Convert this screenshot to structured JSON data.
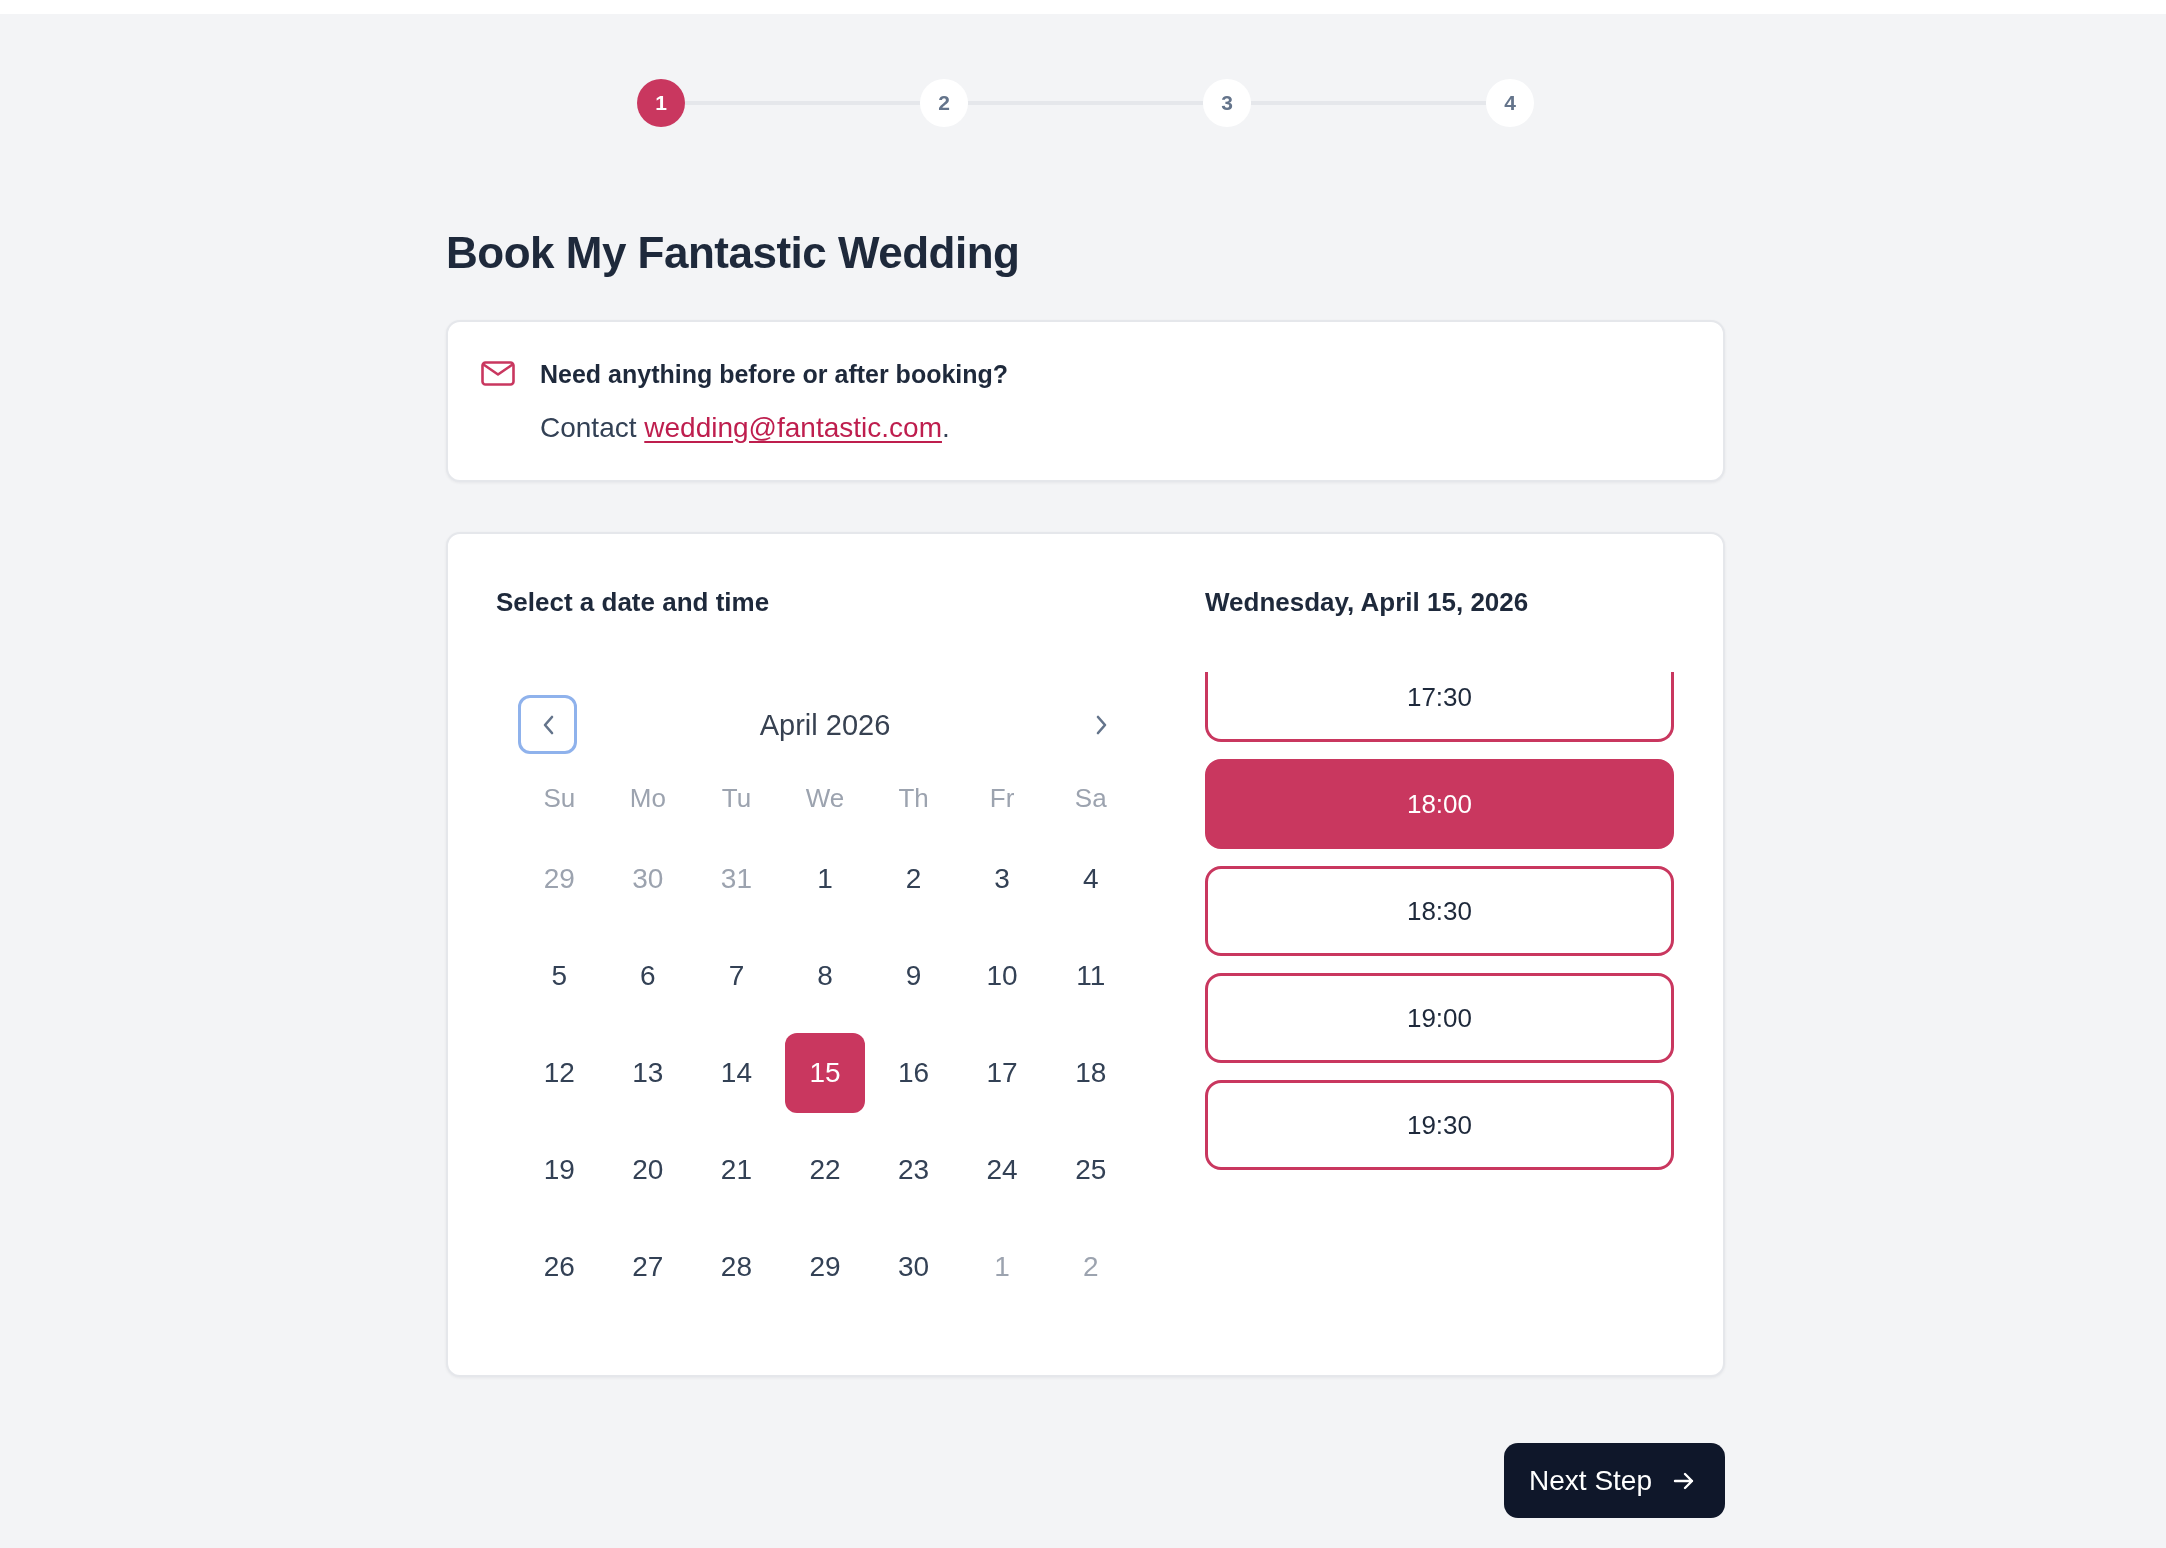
{
  "steps": [
    {
      "label": "1",
      "selected": true
    },
    {
      "label": "2",
      "selected": false
    },
    {
      "label": "3",
      "selected": false
    },
    {
      "label": "4",
      "selected": false
    }
  ],
  "title": "Book My Fantastic Wedding",
  "contact": {
    "heading": "Need anything before or after booking?",
    "prefix": "Contact",
    "email": "wedding@fantastic.com",
    "suffix": "."
  },
  "booking": {
    "heading": "Select a date and time",
    "calendar": {
      "month": "April 2026",
      "prev_button": {
        "focused": true
      },
      "weekdays": [
        "Su",
        "Mo",
        "Tu",
        "We",
        "Th",
        "Fr",
        "Sa"
      ],
      "days": [
        {
          "label": "29",
          "outside_month": true,
          "selected": false
        },
        {
          "label": "30",
          "outside_month": true,
          "selected": false
        },
        {
          "label": "31",
          "outside_month": true,
          "selected": false
        },
        {
          "label": "1",
          "outside_month": false,
          "selected": false
        },
        {
          "label": "2",
          "outside_month": false,
          "selected": false
        },
        {
          "label": "3",
          "outside_month": false,
          "selected": false
        },
        {
          "label": "4",
          "outside_month": false,
          "selected": false
        },
        {
          "label": "5",
          "outside_month": false,
          "selected": false
        },
        {
          "label": "6",
          "outside_month": false,
          "selected": false
        },
        {
          "label": "7",
          "outside_month": false,
          "selected": false
        },
        {
          "label": "8",
          "outside_month": false,
          "selected": false
        },
        {
          "label": "9",
          "outside_month": false,
          "selected": false
        },
        {
          "label": "10",
          "outside_month": false,
          "selected": false
        },
        {
          "label": "11",
          "outside_month": false,
          "selected": false
        },
        {
          "label": "12",
          "outside_month": false,
          "selected": false
        },
        {
          "label": "13",
          "outside_month": false,
          "selected": false
        },
        {
          "label": "14",
          "outside_month": false,
          "selected": false
        },
        {
          "label": "15",
          "outside_month": false,
          "selected": true
        },
        {
          "label": "16",
          "outside_month": false,
          "selected": false
        },
        {
          "label": "17",
          "outside_month": false,
          "selected": false
        },
        {
          "label": "18",
          "outside_month": false,
          "selected": false
        },
        {
          "label": "19",
          "outside_month": false,
          "selected": false
        },
        {
          "label": "20",
          "outside_month": false,
          "selected": false
        },
        {
          "label": "21",
          "outside_month": false,
          "selected": false
        },
        {
          "label": "22",
          "outside_month": false,
          "selected": false
        },
        {
          "label": "23",
          "outside_month": false,
          "selected": false
        },
        {
          "label": "24",
          "outside_month": false,
          "selected": false
        },
        {
          "label": "25",
          "outside_month": false,
          "selected": false
        },
        {
          "label": "26",
          "outside_month": false,
          "selected": false
        },
        {
          "label": "27",
          "outside_month": false,
          "selected": false
        },
        {
          "label": "28",
          "outside_month": false,
          "selected": false
        },
        {
          "label": "29",
          "outside_month": false,
          "selected": false
        },
        {
          "label": "30",
          "outside_month": false,
          "selected": false
        },
        {
          "label": "1",
          "outside_month": true,
          "selected": false
        },
        {
          "label": "2",
          "outside_month": true,
          "selected": false
        }
      ]
    },
    "selected_date": "Wednesday, April 15, 2026",
    "time_slots": [
      {
        "time": "17:30",
        "selected": false
      },
      {
        "time": "18:00",
        "selected": true
      },
      {
        "time": "18:30",
        "selected": false
      },
      {
        "time": "19:00",
        "selected": false
      },
      {
        "time": "19:30",
        "selected": false
      }
    ]
  },
  "next_button": {
    "label": "Next Step"
  }
}
